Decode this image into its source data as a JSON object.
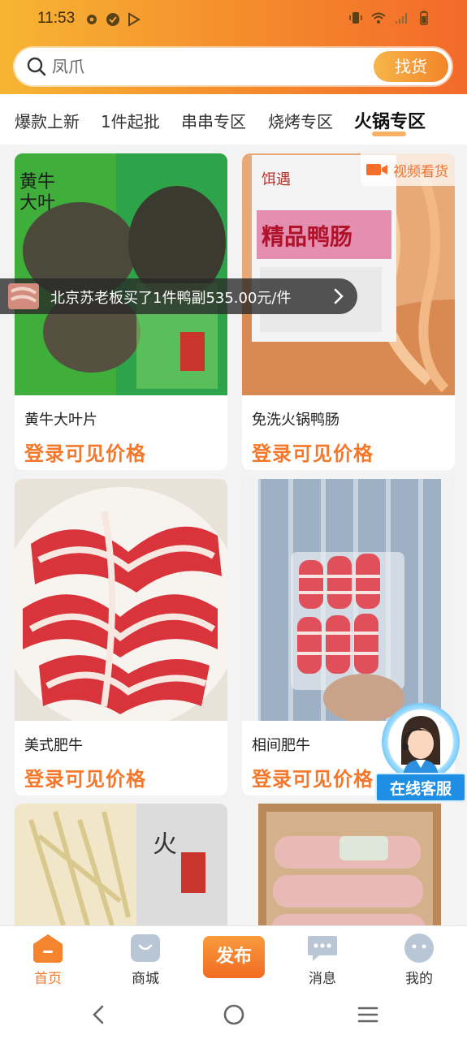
{
  "status_bar": {
    "time": "11:53"
  },
  "search": {
    "query": "凤爪",
    "button_label": "找货"
  },
  "categories": [
    {
      "label": "爆款上新",
      "active": false
    },
    {
      "label": "1件起批",
      "active": false
    },
    {
      "label": "串串专区",
      "active": false
    },
    {
      "label": "烧烤专区",
      "active": false
    },
    {
      "label": "火锅专区",
      "active": true
    }
  ],
  "products": [
    {
      "name": "黄牛大叶片",
      "price_text": "登录可见价格"
    },
    {
      "name": "免洗火锅鸭肠",
      "price_text": "登录可见价格",
      "video_tag": "视频看货"
    },
    {
      "name": "美式肥牛",
      "price_text": "登录可见价格"
    },
    {
      "name": "相间肥牛",
      "price_text": "登录可见价格"
    },
    {
      "name": "",
      "price_text": ""
    },
    {
      "name": "",
      "price_text": ""
    }
  ],
  "ticker": {
    "message": "北京苏老板买了1件鸭副535.00元/件"
  },
  "customer_service": {
    "label": "在线客服"
  },
  "bottom_nav": {
    "items": [
      {
        "label": "首页",
        "active": true
      },
      {
        "label": "商城",
        "active": false
      },
      {
        "label": "发布",
        "active": false
      },
      {
        "label": "消息",
        "active": false
      },
      {
        "label": "我的",
        "active": false
      }
    ]
  },
  "colors": {
    "accent": "#f5782a",
    "header_gradient_start": "#f6b533",
    "header_gradient_end": "#f36a2a",
    "service_blue": "#1f8fe5"
  }
}
